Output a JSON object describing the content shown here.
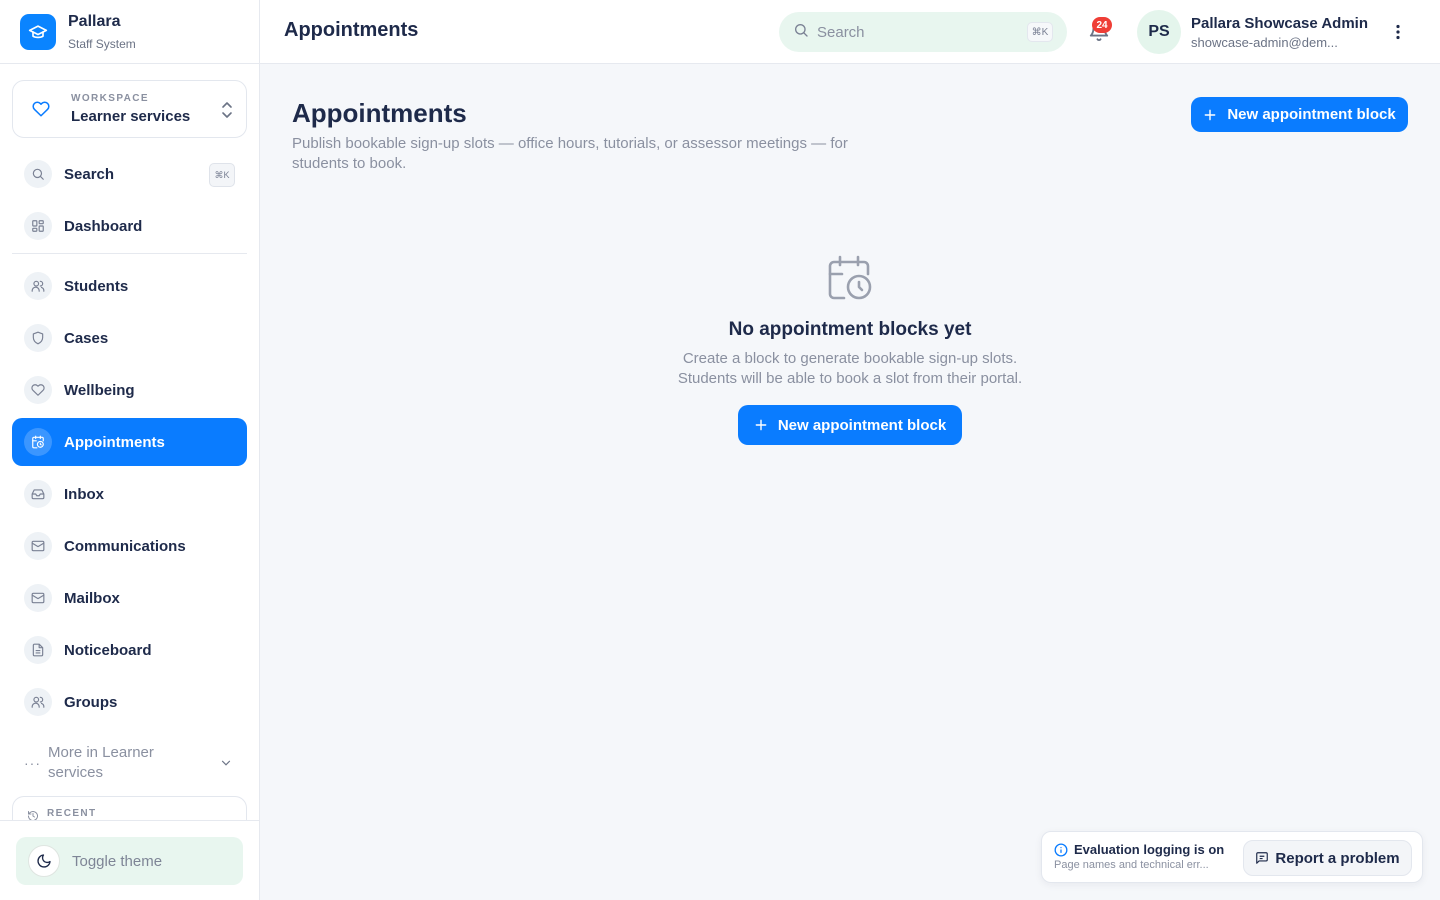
{
  "brand": {
    "name": "Pallara",
    "subtitle": "Staff System"
  },
  "workspace": {
    "label": "WORKSPACE",
    "value": "Learner services"
  },
  "sidebar": {
    "search": {
      "label": "Search",
      "shortcut": "⌘K"
    },
    "items": [
      {
        "label": "Dashboard",
        "icon": "grid-icon"
      },
      {
        "label": "Students",
        "icon": "users-icon"
      },
      {
        "label": "Cases",
        "icon": "shield-icon"
      },
      {
        "label": "Wellbeing",
        "icon": "heart-icon"
      },
      {
        "label": "Appointments",
        "icon": "calendar-clock-icon",
        "active": true
      },
      {
        "label": "Inbox",
        "icon": "inbox-icon"
      },
      {
        "label": "Communications",
        "icon": "mail-icon"
      },
      {
        "label": "Mailbox",
        "icon": "mail-icon"
      },
      {
        "label": "Noticeboard",
        "icon": "file-text-icon"
      },
      {
        "label": "Groups",
        "icon": "user-group-icon"
      }
    ],
    "more": "More in Learner services",
    "recent": "RECENT",
    "toggle_theme": "Toggle theme"
  },
  "topbar": {
    "title": "Appointments",
    "search_placeholder": "Search",
    "search_shortcut": "⌘K",
    "notifications_count": "24",
    "user": {
      "initials": "PS",
      "name": "Pallara Showcase Admin",
      "email": "showcase-admin@dem..."
    }
  },
  "page": {
    "title": "Appointments",
    "description": "Publish bookable sign-up slots — office hours, tutorials, or assessor meetings — for students to book.",
    "new_button": "New appointment block"
  },
  "empty_state": {
    "title": "No appointment blocks yet",
    "line1": "Create a block to generate bookable sign-up slots.",
    "line2": "Students will be able to book a slot from their portal.",
    "button": "New appointment block"
  },
  "eval_banner": {
    "title": "Evaluation logging is on",
    "subtitle": "Page names and technical err...",
    "report_button": "Report a problem"
  },
  "colors": {
    "accent": "#0a7cff",
    "badge": "#ef3e36",
    "mint": "#e8f6ef",
    "text": "#1e2a4a",
    "muted": "#8a90a0"
  }
}
